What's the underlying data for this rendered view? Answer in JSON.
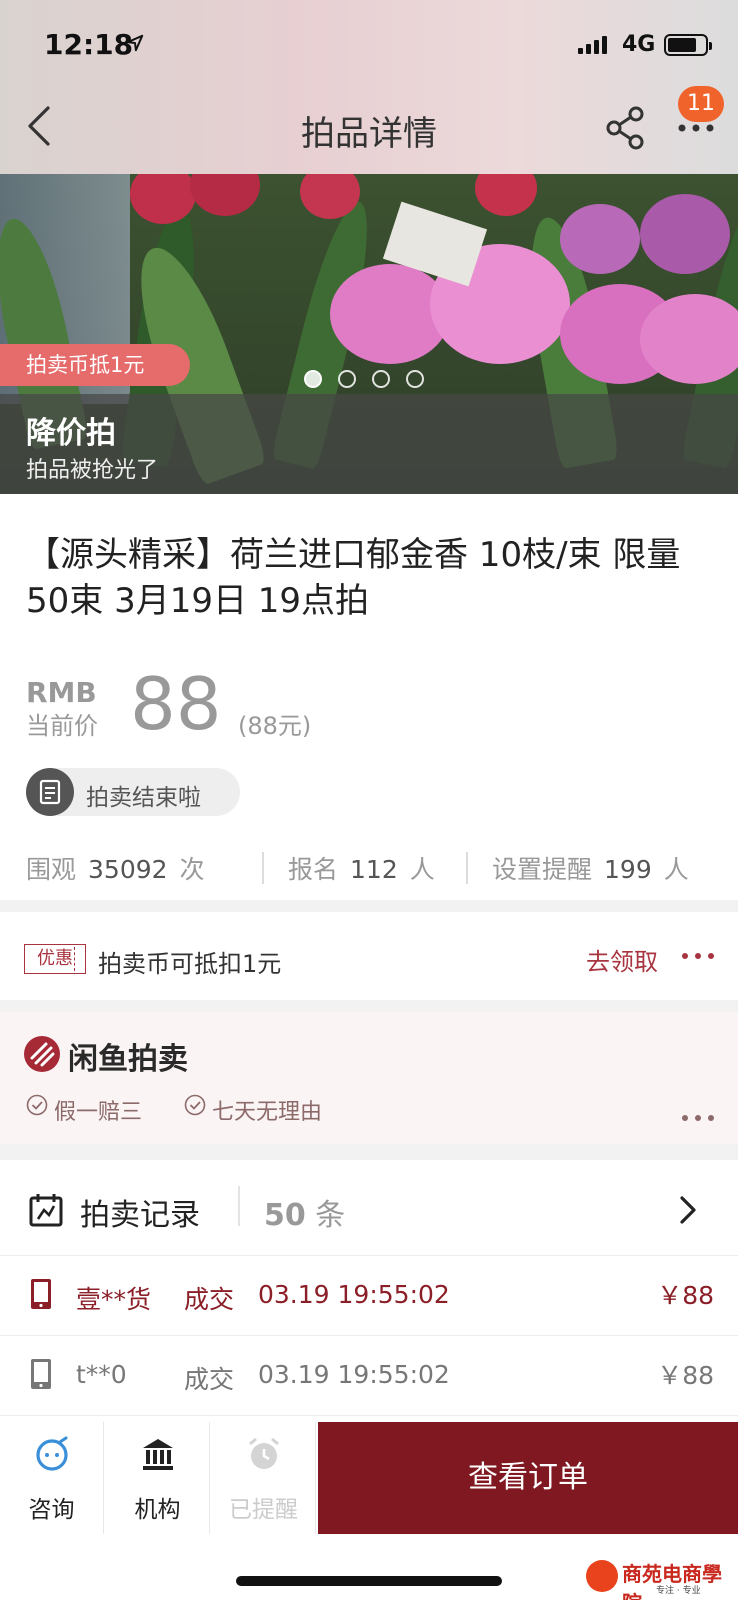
{
  "status_bar": {
    "time": "12:18",
    "network": "4G"
  },
  "nav": {
    "title": "拍品详情",
    "notification_count": "11"
  },
  "hero": {
    "coin_tag": "拍卖币抵1元",
    "image_count": 4,
    "active_index": 0,
    "band_title": "降价拍",
    "band_subtitle": "拍品被抢光了"
  },
  "item": {
    "title": "【源头精采】荷兰进口郁金香 10枝/束 限量50束 3月19日 19点拍",
    "currency": "RMB",
    "price_label": "当前价",
    "price": "88",
    "price_yuan": "(88元)",
    "status": "拍卖结束啦"
  },
  "stats": {
    "views_label": "围观",
    "views": "35092",
    "views_unit": "次",
    "signup_label": "报名",
    "signup": "112",
    "signup_unit": "人",
    "remind_label": "设置提醒",
    "remind": "199",
    "remind_unit": "人"
  },
  "promo": {
    "tag": "优惠",
    "text": "拍卖币可抵扣1元",
    "link": "去领取"
  },
  "brand": {
    "name": "闲鱼拍卖",
    "guarantee1": "假一赔三",
    "guarantee2": "七天无理由"
  },
  "records": {
    "label": "拍卖记录",
    "count": "50",
    "count_unit": "条",
    "rows": [
      {
        "user": "壹**货",
        "status": "成交",
        "time": "03.19 19:55:02",
        "price": "￥88"
      },
      {
        "user": "t**0",
        "status": "成交",
        "time": "03.19 19:55:02",
        "price": "￥88"
      }
    ]
  },
  "bottom_bar": {
    "consult": "咨询",
    "institution": "机构",
    "reminded": "已提醒",
    "order_button": "查看订单"
  },
  "watermark": {
    "text": "商苑电商學院",
    "sub": "专注 · 专业"
  },
  "colors": {
    "accent": "#7f1820",
    "badge": "#f0632a",
    "coin_tag": "#e66b6b",
    "promo": "#a8343f"
  }
}
